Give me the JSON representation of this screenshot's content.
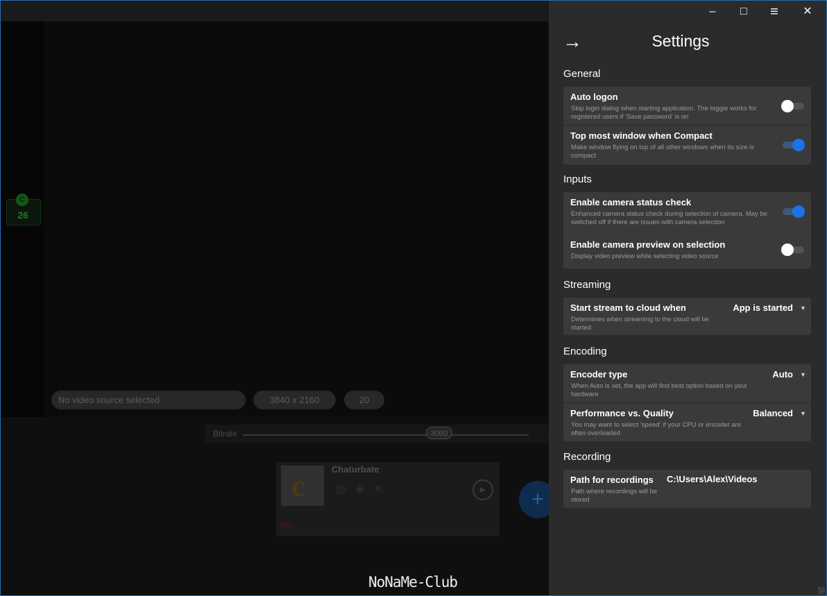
{
  "background": {
    "counter": {
      "badge": "C",
      "value": "26"
    },
    "source_pill": "No video source selected",
    "resolution_pill": "3840 x 2160",
    "fps_pill": "20",
    "bitrate": {
      "label": "Bitrate",
      "value": "3000"
    },
    "destination": {
      "name": "Chaturbate",
      "key_label": "Key"
    },
    "add_button": "+"
  },
  "watermark": "NoNaMe-Club",
  "window_controls": {
    "minimize": "–",
    "maximize": "□",
    "menu": "≡",
    "close": "✕"
  },
  "settings": {
    "back_icon": "→",
    "title": "Settings",
    "sections": {
      "general": {
        "title": "General",
        "auto_logon": {
          "title": "Auto logon",
          "desc": "Skip login dialog when starting application. The toggle works for registered users if 'Save password' is on",
          "state": "off"
        },
        "top_most": {
          "title": "Top most window when Compact",
          "desc": "Make window flying on top of all other windows when its size is compact",
          "state": "on"
        }
      },
      "inputs": {
        "title": "Inputs",
        "camera_check": {
          "title": "Enable camera status check",
          "desc": "Enhanced camera status check during selection of camera. May be switched off if there are issues with camera selection",
          "state": "on"
        },
        "camera_preview": {
          "title": "Enable camera preview on selection",
          "desc": "Display video preview while selecting video source",
          "state": "off"
        }
      },
      "streaming": {
        "title": "Streaming",
        "start_stream": {
          "title": "Start stream to cloud when",
          "desc": "Determines when streaming to the cloud will be started",
          "value": "App is started"
        }
      },
      "encoding": {
        "title": "Encoding",
        "encoder_type": {
          "title": "Encoder type",
          "desc": "When Auto is set, the app will find best option based on your hardware",
          "value": "Auto"
        },
        "perf_quality": {
          "title": "Performance vs. Quality",
          "desc": "You may want to select 'speed' if your CPU or encoder are often overloaded",
          "value": "Balanced"
        }
      },
      "recording": {
        "title": "Recording",
        "path": {
          "title": "Path for recordings",
          "desc": "Path where recordings will be stored",
          "value": "C:\\Users\\Alex\\Videos"
        }
      }
    }
  },
  "colors": {
    "accent": "#1a73e8",
    "panel": "#2b2b2b",
    "card": "#3a3a3a",
    "window_border": "#2a6fb5"
  }
}
